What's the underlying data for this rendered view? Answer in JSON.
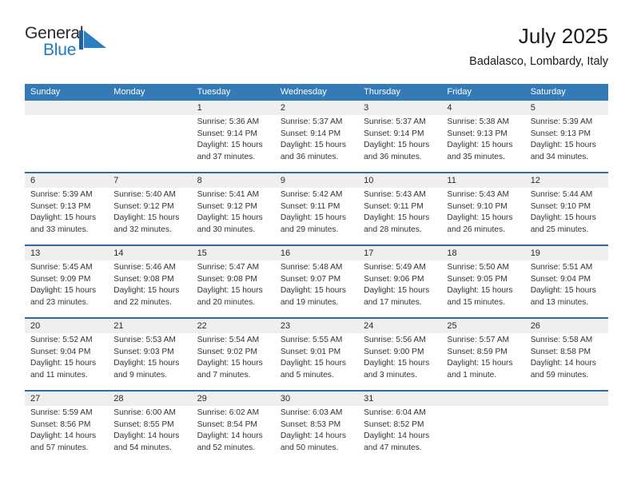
{
  "logo": {
    "word_top": "General",
    "word_bottom": "Blue",
    "mark_name": "blue-triangle-logo-mark",
    "color_dark": "#2b2b2b",
    "color_blue": "#1a7cc4",
    "mark_bar_color": "#1f5fa6",
    "mark_triangle_color": "#2b7fc4"
  },
  "header": {
    "title": "July 2025",
    "subtitle": "Badalasco, Lombardy, Italy"
  },
  "theme": {
    "header_blue": "#337ab7",
    "row_rule_blue": "#2e6da4",
    "daynum_band_gray": "#efefef",
    "text_color": "#333333"
  },
  "weekdays": [
    "Sunday",
    "Monday",
    "Tuesday",
    "Wednesday",
    "Thursday",
    "Friday",
    "Saturday"
  ],
  "weeks": [
    {
      "days": [
        {
          "num": "",
          "lines": []
        },
        {
          "num": "",
          "lines": []
        },
        {
          "num": "1",
          "lines": [
            "Sunrise: 5:36 AM",
            "Sunset: 9:14 PM",
            "Daylight: 15 hours",
            "and 37 minutes."
          ]
        },
        {
          "num": "2",
          "lines": [
            "Sunrise: 5:37 AM",
            "Sunset: 9:14 PM",
            "Daylight: 15 hours",
            "and 36 minutes."
          ]
        },
        {
          "num": "3",
          "lines": [
            "Sunrise: 5:37 AM",
            "Sunset: 9:14 PM",
            "Daylight: 15 hours",
            "and 36 minutes."
          ]
        },
        {
          "num": "4",
          "lines": [
            "Sunrise: 5:38 AM",
            "Sunset: 9:13 PM",
            "Daylight: 15 hours",
            "and 35 minutes."
          ]
        },
        {
          "num": "5",
          "lines": [
            "Sunrise: 5:39 AM",
            "Sunset: 9:13 PM",
            "Daylight: 15 hours",
            "and 34 minutes."
          ]
        }
      ]
    },
    {
      "days": [
        {
          "num": "6",
          "lines": [
            "Sunrise: 5:39 AM",
            "Sunset: 9:13 PM",
            "Daylight: 15 hours",
            "and 33 minutes."
          ]
        },
        {
          "num": "7",
          "lines": [
            "Sunrise: 5:40 AM",
            "Sunset: 9:12 PM",
            "Daylight: 15 hours",
            "and 32 minutes."
          ]
        },
        {
          "num": "8",
          "lines": [
            "Sunrise: 5:41 AM",
            "Sunset: 9:12 PM",
            "Daylight: 15 hours",
            "and 30 minutes."
          ]
        },
        {
          "num": "9",
          "lines": [
            "Sunrise: 5:42 AM",
            "Sunset: 9:11 PM",
            "Daylight: 15 hours",
            "and 29 minutes."
          ]
        },
        {
          "num": "10",
          "lines": [
            "Sunrise: 5:43 AM",
            "Sunset: 9:11 PM",
            "Daylight: 15 hours",
            "and 28 minutes."
          ]
        },
        {
          "num": "11",
          "lines": [
            "Sunrise: 5:43 AM",
            "Sunset: 9:10 PM",
            "Daylight: 15 hours",
            "and 26 minutes."
          ]
        },
        {
          "num": "12",
          "lines": [
            "Sunrise: 5:44 AM",
            "Sunset: 9:10 PM",
            "Daylight: 15 hours",
            "and 25 minutes."
          ]
        }
      ]
    },
    {
      "days": [
        {
          "num": "13",
          "lines": [
            "Sunrise: 5:45 AM",
            "Sunset: 9:09 PM",
            "Daylight: 15 hours",
            "and 23 minutes."
          ]
        },
        {
          "num": "14",
          "lines": [
            "Sunrise: 5:46 AM",
            "Sunset: 9:08 PM",
            "Daylight: 15 hours",
            "and 22 minutes."
          ]
        },
        {
          "num": "15",
          "lines": [
            "Sunrise: 5:47 AM",
            "Sunset: 9:08 PM",
            "Daylight: 15 hours",
            "and 20 minutes."
          ]
        },
        {
          "num": "16",
          "lines": [
            "Sunrise: 5:48 AM",
            "Sunset: 9:07 PM",
            "Daylight: 15 hours",
            "and 19 minutes."
          ]
        },
        {
          "num": "17",
          "lines": [
            "Sunrise: 5:49 AM",
            "Sunset: 9:06 PM",
            "Daylight: 15 hours",
            "and 17 minutes."
          ]
        },
        {
          "num": "18",
          "lines": [
            "Sunrise: 5:50 AM",
            "Sunset: 9:05 PM",
            "Daylight: 15 hours",
            "and 15 minutes."
          ]
        },
        {
          "num": "19",
          "lines": [
            "Sunrise: 5:51 AM",
            "Sunset: 9:04 PM",
            "Daylight: 15 hours",
            "and 13 minutes."
          ]
        }
      ]
    },
    {
      "days": [
        {
          "num": "20",
          "lines": [
            "Sunrise: 5:52 AM",
            "Sunset: 9:04 PM",
            "Daylight: 15 hours",
            "and 11 minutes."
          ]
        },
        {
          "num": "21",
          "lines": [
            "Sunrise: 5:53 AM",
            "Sunset: 9:03 PM",
            "Daylight: 15 hours",
            "and 9 minutes."
          ]
        },
        {
          "num": "22",
          "lines": [
            "Sunrise: 5:54 AM",
            "Sunset: 9:02 PM",
            "Daylight: 15 hours",
            "and 7 minutes."
          ]
        },
        {
          "num": "23",
          "lines": [
            "Sunrise: 5:55 AM",
            "Sunset: 9:01 PM",
            "Daylight: 15 hours",
            "and 5 minutes."
          ]
        },
        {
          "num": "24",
          "lines": [
            "Sunrise: 5:56 AM",
            "Sunset: 9:00 PM",
            "Daylight: 15 hours",
            "and 3 minutes."
          ]
        },
        {
          "num": "25",
          "lines": [
            "Sunrise: 5:57 AM",
            "Sunset: 8:59 PM",
            "Daylight: 15 hours",
            "and 1 minute."
          ]
        },
        {
          "num": "26",
          "lines": [
            "Sunrise: 5:58 AM",
            "Sunset: 8:58 PM",
            "Daylight: 14 hours",
            "and 59 minutes."
          ]
        }
      ]
    },
    {
      "days": [
        {
          "num": "27",
          "lines": [
            "Sunrise: 5:59 AM",
            "Sunset: 8:56 PM",
            "Daylight: 14 hours",
            "and 57 minutes."
          ]
        },
        {
          "num": "28",
          "lines": [
            "Sunrise: 6:00 AM",
            "Sunset: 8:55 PM",
            "Daylight: 14 hours",
            "and 54 minutes."
          ]
        },
        {
          "num": "29",
          "lines": [
            "Sunrise: 6:02 AM",
            "Sunset: 8:54 PM",
            "Daylight: 14 hours",
            "and 52 minutes."
          ]
        },
        {
          "num": "30",
          "lines": [
            "Sunrise: 6:03 AM",
            "Sunset: 8:53 PM",
            "Daylight: 14 hours",
            "and 50 minutes."
          ]
        },
        {
          "num": "31",
          "lines": [
            "Sunrise: 6:04 AM",
            "Sunset: 8:52 PM",
            "Daylight: 14 hours",
            "and 47 minutes."
          ]
        },
        {
          "num": "",
          "lines": []
        },
        {
          "num": "",
          "lines": []
        }
      ]
    }
  ]
}
